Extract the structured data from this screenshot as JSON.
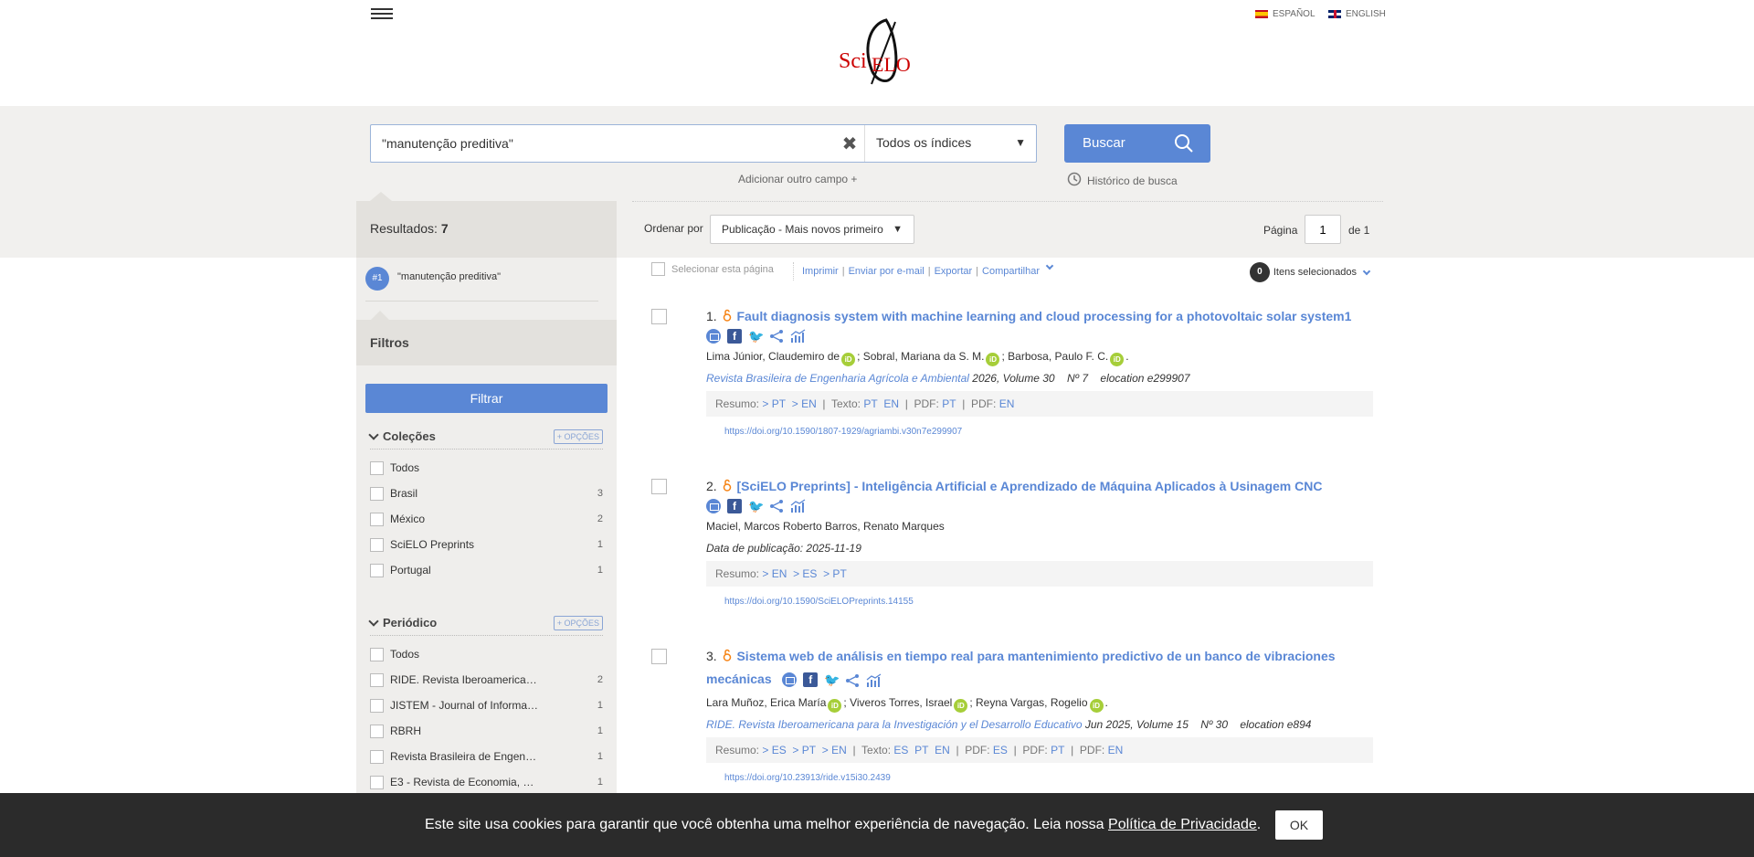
{
  "header": {
    "lang_es": "ESPAÑOL",
    "lang_en": "ENGLISH",
    "logo_text": "SciELO"
  },
  "search": {
    "query": "\"manutenção preditiva\"",
    "index_select": "Todos os índices",
    "buscar_label": "Buscar",
    "add_field": "Adicionar outro campo +",
    "history": "Histórico de busca"
  },
  "sidebar": {
    "results_label": "Resultados:",
    "results_count": "7",
    "query_badge": "#1",
    "query_text": "\"manutenção preditiva\"",
    "filters_title": "Filtros",
    "filter_button": "Filtrar",
    "groups": [
      {
        "title": "Coleções",
        "options_label": "+ OPÇÕES",
        "items": [
          {
            "label": "Todos",
            "count": ""
          },
          {
            "label": "Brasil",
            "count": "3"
          },
          {
            "label": "México",
            "count": "2"
          },
          {
            "label": "SciELO Preprints",
            "count": "1"
          },
          {
            "label": "Portugal",
            "count": "1"
          }
        ]
      },
      {
        "title": "Periódico",
        "options_label": "+ OPÇÕES",
        "items": [
          {
            "label": "Todos",
            "count": ""
          },
          {
            "label": "RIDE. Revista Iberoamerica…",
            "count": "2"
          },
          {
            "label": "JISTEM - Journal of Informa…",
            "count": "1"
          },
          {
            "label": "RBRH",
            "count": "1"
          },
          {
            "label": "Revista Brasileira de Engen…",
            "count": "1"
          },
          {
            "label": "E3 - Revista de Economia, …",
            "count": "1"
          }
        ]
      }
    ]
  },
  "results_bar": {
    "order_label": "Ordenar por",
    "order_value": "Publicação - Mais novos primeiro",
    "page_label": "Página",
    "page_value": "1",
    "page_total": "de 1"
  },
  "toolbar": {
    "select_page": "Selecionar esta página",
    "print": "Imprimir",
    "email": "Enviar por e-mail",
    "export": "Exportar",
    "share": "Compartilhar",
    "selected_count": "0",
    "selected_label": "Itens selecionados"
  },
  "results": [
    {
      "num": "1.",
      "title": "Fault diagnosis system with machine learning and cloud processing for a photovoltaic solar system1",
      "authors": [
        "Lima Júnior, Claudemiro de",
        "Sobral, Mariana da S. M.",
        "Barbosa, Paulo F. C."
      ],
      "journal": "Revista Brasileira de Engenharia Agrícola e Ambiental",
      "year": "2026,",
      "volume_label": "Volume",
      "volume": "30",
      "number_label": "Nº",
      "number": "7",
      "elocation_label": "elocation",
      "elocation": "e299907",
      "doi": "https://doi.org/10.1590/1807-1929/agriambi.v30n7e299907"
    },
    {
      "num": "2.",
      "title": "[SciELO Preprints] - Inteligência Artificial e Aprendizado de Máquina Aplicados à Usinagem CNC",
      "authors_text": "Maciel, Marcos Roberto Barros, Renato Marques",
      "pubdate": "Data de publicação: 2025-11-19",
      "doi": "https://doi.org/10.1590/SciELOPreprints.14155"
    },
    {
      "num": "3.",
      "title": "Sistema web de análisis en tiempo real para mantenimiento predictivo de un banco de vibraciones mecánicas",
      "authors": [
        "Lara Muñoz, Erica María",
        "Viveros Torres, Israel",
        "Reyna Vargas, Rogelio"
      ],
      "journal": "RIDE. Revista Iberoamericana para la Investigación y el Desarrollo Educativo",
      "year": "Jun 2025,",
      "volume_label": "Volume",
      "volume": "15",
      "number_label": "Nº",
      "number": "30",
      "elocation_label": "elocation",
      "elocation": "e894",
      "doi": "https://doi.org/10.23913/ride.v15i30.2439"
    }
  ],
  "links": {
    "resumo": "Resumo:",
    "texto": "Texto:",
    "pdf": "PDF:",
    "pt_arrow": "> PT",
    "en_arrow": "> EN",
    "es_arrow": "> ES",
    "pt": "PT",
    "en": "EN",
    "es": "ES",
    "bar": "|"
  },
  "cookie": {
    "text": "Este site usa cookies para garantir que você obtenha uma melhor experiência de navegação. Leia nossa",
    "link": "Política de Privacidade",
    "ok": "OK"
  },
  "colors": {
    "accent": "#5a87d5",
    "band": "#f1f0ee",
    "sidebar": "#efeeec",
    "cookie_bg": "#2b2b2b",
    "orcid": "#a6ce39"
  }
}
